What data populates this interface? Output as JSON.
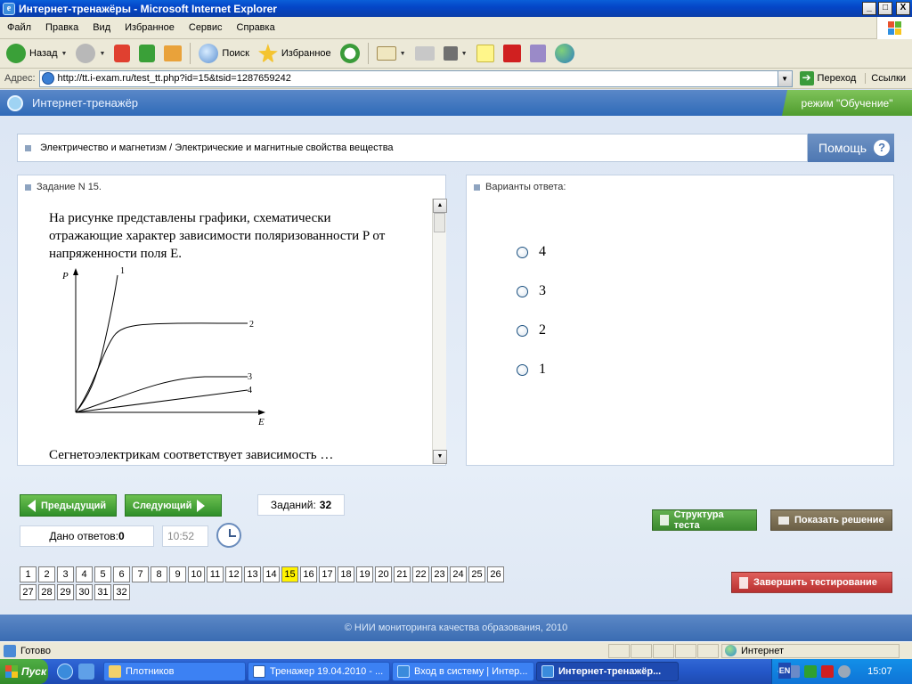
{
  "window": {
    "title": "Интернет-тренажёры - Microsoft Internet Explorer",
    "app_icon": "ie-icon",
    "controls": {
      "minimize": "_",
      "maximize": "□",
      "close": "X"
    }
  },
  "menu": [
    "Файл",
    "Правка",
    "Вид",
    "Избранное",
    "Сервис",
    "Справка"
  ],
  "toolbar": {
    "back_label": "Назад",
    "search_label": "Поиск",
    "favorites_label": "Избранное"
  },
  "address": {
    "label": "Адрес:",
    "url": "http://tt.i-exam.ru/test_tt.php?id=15&tsid=1287659242",
    "go_label": "Переход",
    "links_label": "Ссылки"
  },
  "app": {
    "title": "Интернет-тренажёр",
    "mode": "режим \"Обучение\"",
    "breadcrumb": "Электричество и магнетизм / Электрические и магнитные свойства вещества",
    "help_label": "Помощь",
    "help_icon_text": "?"
  },
  "task": {
    "header": "Задание N 15.",
    "text": "На рисунке представлены графики, схематически отражающие характер зависимости поляризованности P от напряженности поля E.",
    "question": "Сегнетоэлектрикам соответствует зависимость …",
    "graph": {
      "y_axis_label": "P",
      "x_axis_label": "E",
      "curve_labels": [
        "1",
        "2",
        "3",
        "4"
      ]
    }
  },
  "answers": {
    "header": "Варианты ответа:",
    "options": [
      "4",
      "3",
      "2",
      "1"
    ]
  },
  "controls": {
    "prev_label": "Предыдущий",
    "next_label": "Следующий",
    "tasks_label": "Заданий:",
    "tasks_count": "32",
    "answered_label": "Дано ответов:",
    "answered_count": "0",
    "time": "10:52",
    "structure_label": "Структура теста",
    "solution_label": "Показать решение",
    "finish_label": "Завершить тестирование"
  },
  "pager": {
    "pages": [
      "1",
      "2",
      "3",
      "4",
      "5",
      "6",
      "7",
      "8",
      "9",
      "10",
      "11",
      "12",
      "13",
      "14",
      "15",
      "16",
      "17",
      "18",
      "19",
      "20",
      "21",
      "22",
      "23",
      "24",
      "25",
      "26",
      "27",
      "28",
      "29",
      "30",
      "31",
      "32"
    ],
    "current": "15",
    "current_color": "#fff200"
  },
  "footer": "© НИИ мониторинга качества образования, 2010",
  "statusbar": {
    "status": "Готово",
    "zone": "Интернет"
  },
  "taskbar": {
    "start_label": "Пуск",
    "items": [
      "Плотников",
      "Тренажер 19.04.2010 - ...",
      "Вход в систему | Интер...",
      "Интернет-тренажёр..."
    ],
    "lang": "EN",
    "clock": "15:07"
  },
  "colors": {
    "accent_blue": "#3a6cb2",
    "green_button": "#3a8a2e",
    "finish_red": "#b83030",
    "mode_green": "#4f9c2e"
  }
}
